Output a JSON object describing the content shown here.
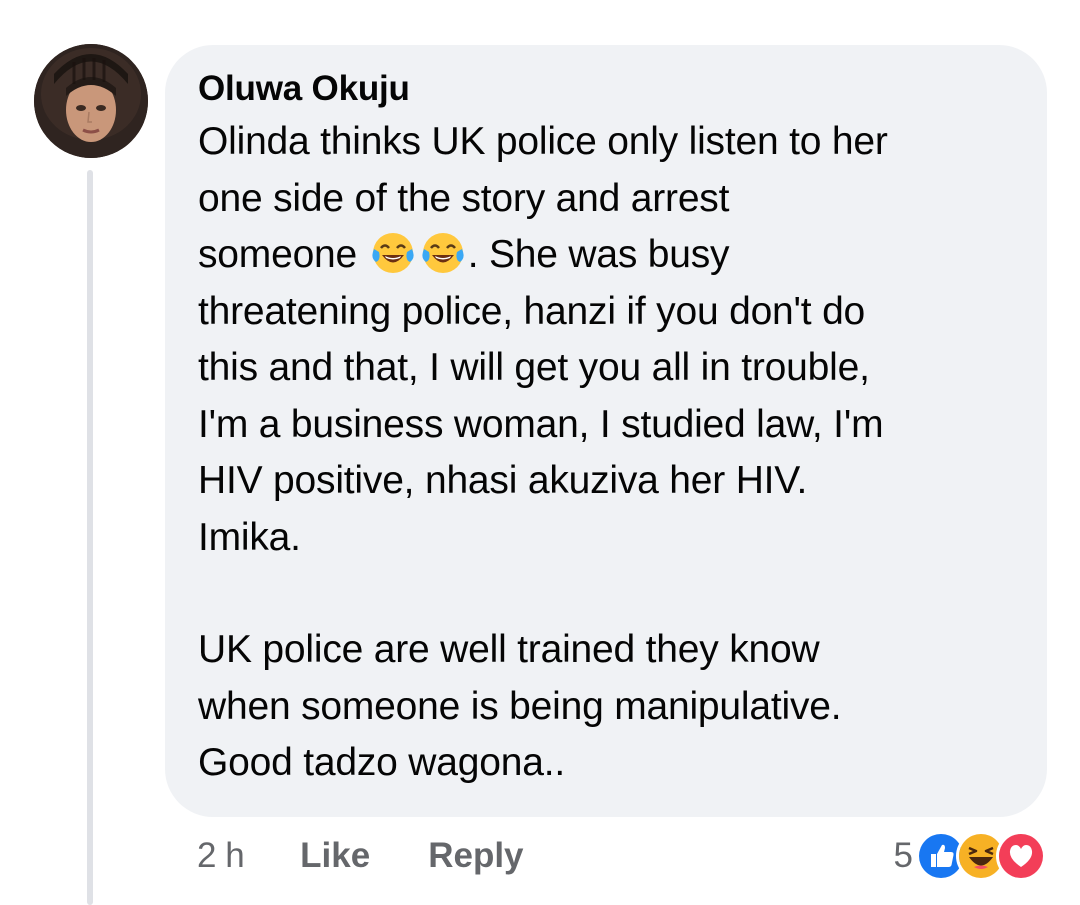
{
  "comment": {
    "author": "Oluwa Okuju",
    "paragraphs": [
      {
        "before_emoji": "Olinda thinks UK police only listen to her\none side of the story and arrest\nsomeone ",
        "emojis": [
          "tears-of-joy-emoji",
          "tears-of-joy-emoji"
        ],
        "after_emoji": ". She was busy\nthreatening police, hanzi if you don't do\nthis and that, I will get you all in trouble,\nI'm a business woman, I studied law, I'm\nHIV positive, nhasi akuziva her HIV.\nImika."
      },
      {
        "text": "UK police are well trained they know\nwhen someone is being manipulative.\nGood tadzo wagona.."
      }
    ]
  },
  "actions": {
    "time": "2 h",
    "like": "Like",
    "reply": "Reply"
  },
  "reactions": {
    "count": "5",
    "icons": [
      "like-reaction-icon",
      "haha-reaction-icon",
      "love-reaction-icon"
    ],
    "colors": {
      "like": "#1877f2",
      "haha": "#f7b125",
      "love": "#f33e58"
    }
  },
  "colors": {
    "bubble": "#f0f2f5",
    "text": "#050505",
    "secondary": "#65676b"
  }
}
